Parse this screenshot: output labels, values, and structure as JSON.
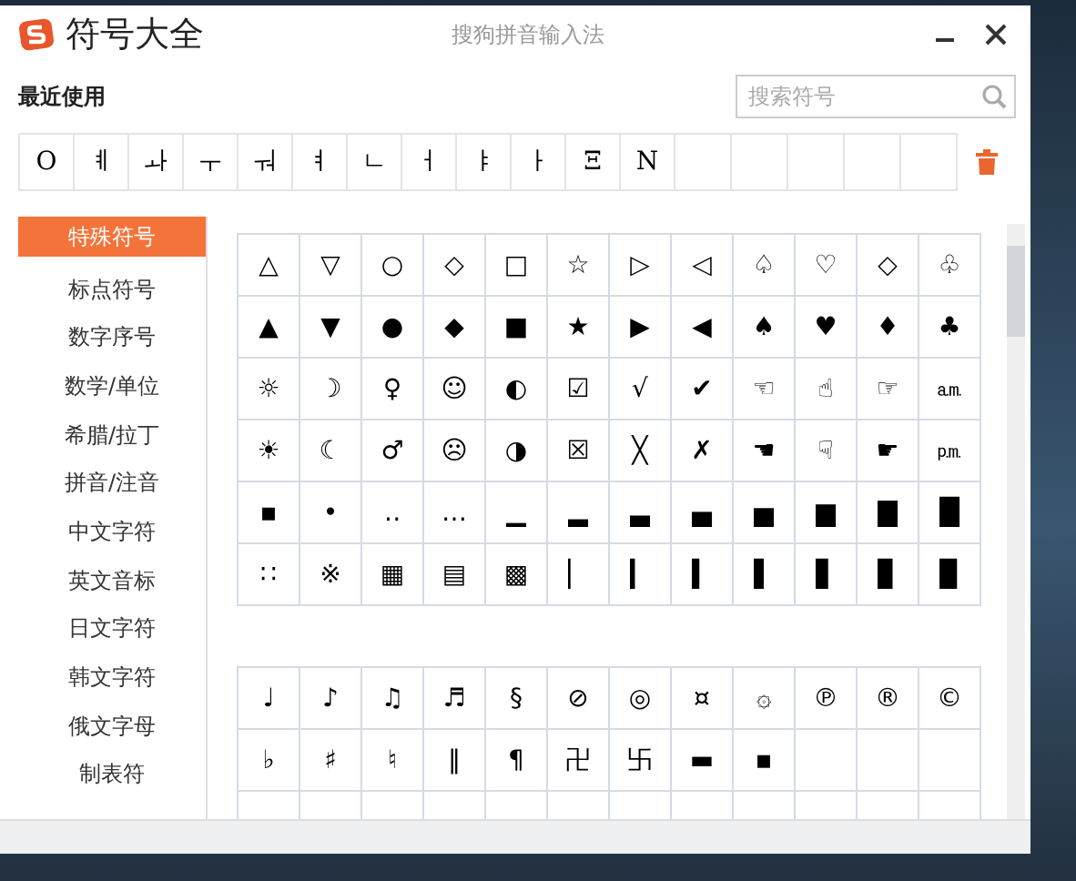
{
  "window": {
    "title": "符号大全",
    "subtitle": "搜狗拼音输入法"
  },
  "recent": {
    "label": "最近使用",
    "symbols": [
      "O",
      "ㅖ",
      "ㅘ",
      "ㅜ",
      "ㅝ",
      "ㅕ",
      "ㄴ",
      "ㅓ",
      "ㅑ",
      "ㅏ",
      "Ξ",
      "N"
    ]
  },
  "search": {
    "placeholder": "搜索符号"
  },
  "sidebar": {
    "items": [
      {
        "label": "特殊符号",
        "selected": true
      },
      {
        "label": "标点符号",
        "selected": false
      },
      {
        "label": "数字序号",
        "selected": false
      },
      {
        "label": "数学/单位",
        "selected": false
      },
      {
        "label": "希腊/拉丁",
        "selected": false
      },
      {
        "label": "拼音/注音",
        "selected": false
      },
      {
        "label": "中文字符",
        "selected": false
      },
      {
        "label": "英文音标",
        "selected": false
      },
      {
        "label": "日文字符",
        "selected": false
      },
      {
        "label": "韩文字符",
        "selected": false
      },
      {
        "label": "俄文字母",
        "selected": false
      },
      {
        "label": "制表符",
        "selected": false
      }
    ]
  },
  "groups": [
    {
      "rows": [
        [
          "△",
          "▽",
          "○",
          "◇",
          "□",
          "☆",
          "▷",
          "◁",
          "♤",
          "♡",
          "◇",
          "♧"
        ],
        [
          "▲",
          "▼",
          "●",
          "◆",
          "■",
          "★",
          "▶",
          "◀",
          "♠",
          "♥",
          "♦",
          "♣"
        ],
        [
          "☼",
          "☽",
          "♀",
          "☺",
          "◐",
          "☑",
          "√",
          "✔",
          "☜",
          "☝",
          "☞",
          "㏂"
        ],
        [
          "☀",
          "☾",
          "♂",
          "☹",
          "◑",
          "☒",
          "╳",
          "✗",
          "☚",
          "☟",
          "☛",
          "㏘"
        ],
        [
          "▪",
          "•",
          "‥",
          "…",
          "▁",
          "▂",
          "▃",
          "▄",
          "▅",
          "▆",
          "▇",
          "█"
        ],
        [
          "∷",
          "※",
          "▦",
          "▤",
          "▩",
          "▏",
          "▎",
          "▍",
          "▌",
          "▋",
          "▊",
          "▉"
        ]
      ]
    },
    {
      "rows": [
        [
          "♩",
          "♪",
          "♫",
          "♬",
          "§",
          "⊘",
          "◎",
          "¤",
          "۞",
          "℗",
          "®",
          "©"
        ],
        [
          "♭",
          "♯",
          "♮",
          "‖",
          "¶",
          "卍",
          "卐",
          "▬",
          "▪"
        ]
      ]
    }
  ]
}
